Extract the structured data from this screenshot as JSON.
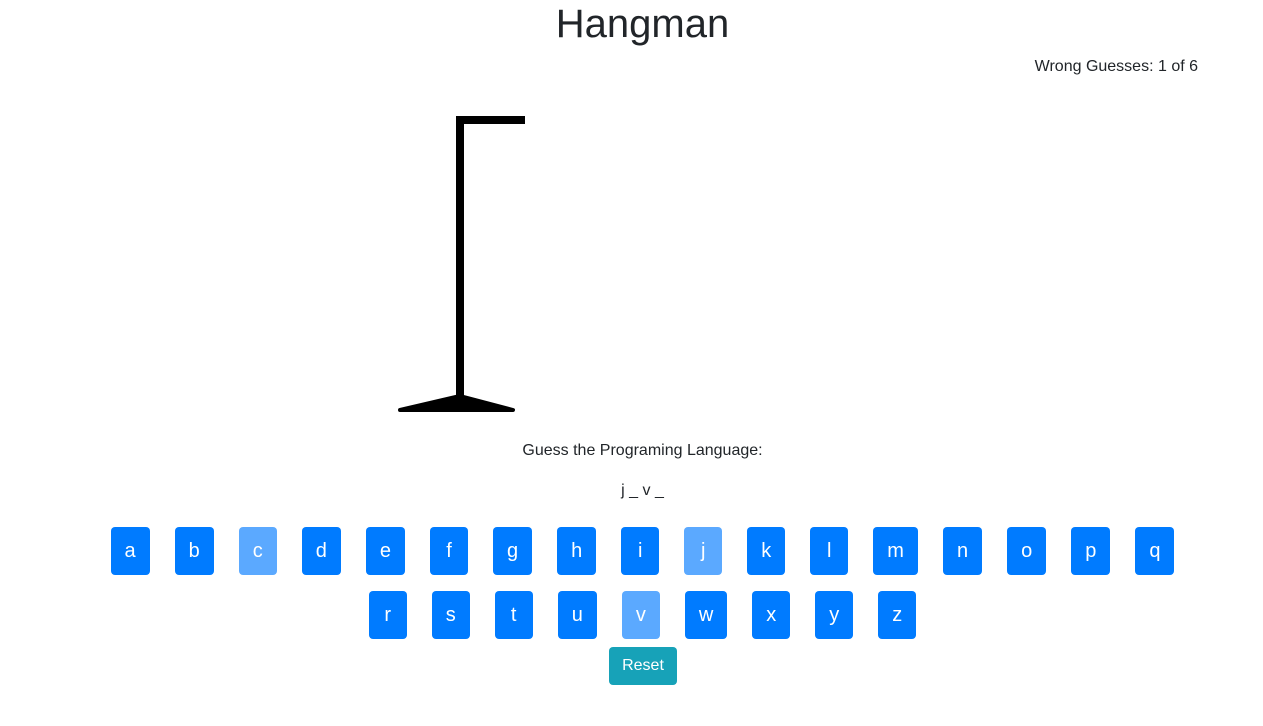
{
  "title": "Hangman",
  "status": {
    "wrong_label": "Wrong Guesses: ",
    "wrong_count": 1,
    "max_wrong": 6,
    "wrong_text": "Wrong Guesses: 1 of 6"
  },
  "prompt": "Guess the Programing Language:",
  "word_display": "j _ v _",
  "keyboard": {
    "row1": [
      {
        "letter": "a",
        "used": false
      },
      {
        "letter": "b",
        "used": false
      },
      {
        "letter": "c",
        "used": true
      },
      {
        "letter": "d",
        "used": false
      },
      {
        "letter": "e",
        "used": false
      },
      {
        "letter": "f",
        "used": false
      },
      {
        "letter": "g",
        "used": false
      },
      {
        "letter": "h",
        "used": false
      },
      {
        "letter": "i",
        "used": false
      },
      {
        "letter": "j",
        "used": true
      },
      {
        "letter": "k",
        "used": false
      },
      {
        "letter": "l",
        "used": false
      },
      {
        "letter": "m",
        "used": false
      },
      {
        "letter": "n",
        "used": false
      },
      {
        "letter": "o",
        "used": false
      },
      {
        "letter": "p",
        "used": false
      },
      {
        "letter": "q",
        "used": false
      }
    ],
    "row2": [
      {
        "letter": "r",
        "used": false
      },
      {
        "letter": "s",
        "used": false
      },
      {
        "letter": "t",
        "used": false
      },
      {
        "letter": "u",
        "used": false
      },
      {
        "letter": "v",
        "used": true
      },
      {
        "letter": "w",
        "used": false
      },
      {
        "letter": "x",
        "used": false
      },
      {
        "letter": "y",
        "used": false
      },
      {
        "letter": "z",
        "used": false
      }
    ]
  },
  "reset_label": "Reset",
  "colors": {
    "key": "#007bff",
    "key_used": "#5ba9ff",
    "reset": "#17a2b8",
    "drawing": "#000000"
  }
}
